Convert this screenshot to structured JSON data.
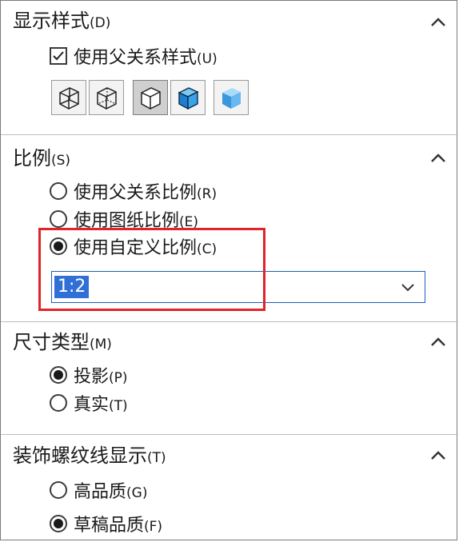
{
  "display_style": {
    "title": "显示样式",
    "title_key": "(D)",
    "use_parent_style": {
      "label": "使用父关系样式",
      "key": "(U)",
      "checked": true
    },
    "style_buttons": [
      {
        "name": "wireframe-icon",
        "active": false
      },
      {
        "name": "hidden-lines-visible-icon",
        "active": false
      },
      {
        "name": "hidden-lines-removed-icon",
        "active": true
      },
      {
        "name": "shaded-with-edges-icon",
        "active": false
      },
      {
        "name": "shaded-icon",
        "active": false
      }
    ]
  },
  "scale": {
    "title": "比例",
    "title_key": "(S)",
    "options": [
      {
        "label": "使用父关系比例",
        "key": "(R)",
        "selected": false
      },
      {
        "label": "使用图纸比例",
        "key": "(E)",
        "selected": false
      },
      {
        "label": "使用自定义比例",
        "key": "(C)",
        "selected": true
      }
    ],
    "custom_value": "1:2"
  },
  "dimension_type": {
    "title": "尺寸类型",
    "title_key": "(M)",
    "options": [
      {
        "label": "投影",
        "key": "(P)",
        "selected": true
      },
      {
        "label": "真实",
        "key": "(T)",
        "selected": false
      }
    ]
  },
  "cosmetic_thread": {
    "title": "装饰螺纹线显示",
    "title_key": "(T)",
    "options": [
      {
        "label": "高品质",
        "key": "(G)",
        "selected": false
      },
      {
        "label": "草稿品质",
        "key": "(F)",
        "selected": true
      }
    ]
  },
  "colors": {
    "highlight": "#e0242b",
    "selection": "#2f6fd6",
    "combo_border": "#1f5fb8"
  }
}
